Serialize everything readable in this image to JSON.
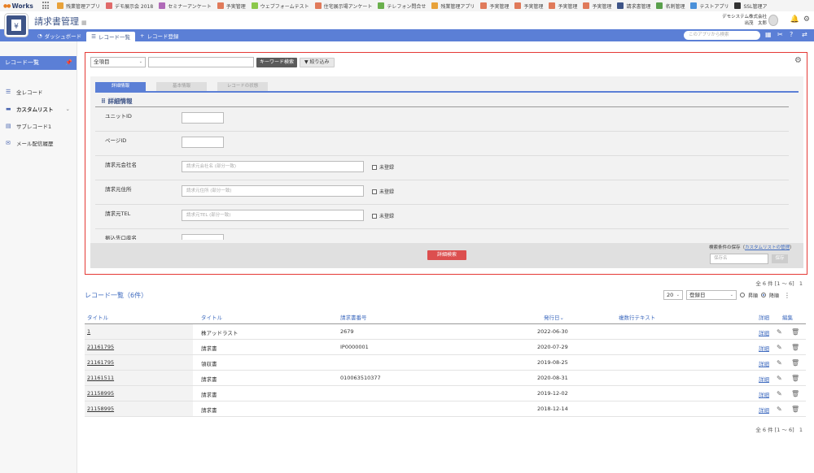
{
  "topbar": {
    "logo_text": "Works",
    "apps": [
      {
        "label": "残業管理アプリ",
        "color": "#e8a23a"
      },
      {
        "label": "デモ展示会 2018",
        "color": "#e06a6a"
      },
      {
        "label": "セミナーアンケート",
        "color": "#b06ab8"
      },
      {
        "label": "予実管理",
        "color": "#e07a5a"
      },
      {
        "label": "ウェブフォームテスト",
        "color": "#8cc84b"
      },
      {
        "label": "住宅展示場アンケート",
        "color": "#e07a5a"
      },
      {
        "label": "テレフォン問合せ",
        "color": "#6ab04c"
      },
      {
        "label": "残業管理アプリ",
        "color": "#e8a23a"
      },
      {
        "label": "予実管理",
        "color": "#e07a5a"
      },
      {
        "label": "予実管理",
        "color": "#e07a5a"
      },
      {
        "label": "予実管理",
        "color": "#e07a5a"
      },
      {
        "label": "予実管理",
        "color": "#e07a5a"
      },
      {
        "label": "請求書管理",
        "color": "#3e5487"
      },
      {
        "label": "名刺管理",
        "color": "#5aa04c"
      },
      {
        "label": "テストアプリ",
        "color": "#4a90d9"
      },
      {
        "label": "SSL管理ア",
        "color": "#333333"
      }
    ]
  },
  "header": {
    "app_title": "請求書管理",
    "calendar_glyph": "▦",
    "company": "デモシステム株式会社",
    "user": "出茂　太郎"
  },
  "nav": {
    "tabs": [
      "ダッシュボード",
      "レコード一覧",
      "レコード登録"
    ],
    "active_tab": 1,
    "search_placeholder": "このアプリから検索"
  },
  "sidebar": {
    "header": "レコード一覧",
    "items": [
      "全レコード",
      "カスタムリスト",
      "サブレコード1",
      "メール配信履歴"
    ]
  },
  "search": {
    "field_select": "全項目",
    "keyword_button": "キーワード検索",
    "filter_button": "絞り込み",
    "tabs": [
      "詳細情報",
      "基本情報",
      "レコードの状態"
    ],
    "section_title": "詳細情報",
    "fields": [
      {
        "label": "ユニットID",
        "placeholder": "",
        "checkbox": ""
      },
      {
        "label": "ページID",
        "placeholder": "",
        "checkbox": ""
      },
      {
        "label": "請求元会社名",
        "placeholder": "請求元会社名 (部分一致)",
        "checkbox": "未登録"
      },
      {
        "label": "請求元住所",
        "placeholder": "請求元住所 (部分一致)",
        "checkbox": "未登録"
      },
      {
        "label": "請求元TEL",
        "placeholder": "請求元TEL (部分一致)",
        "checkbox": "未登録"
      },
      {
        "label": "振込先口座名",
        "placeholder": "",
        "checkbox": ""
      }
    ],
    "detail_search_button": "詳細検索",
    "save_label_prefix": "検索条件の保存（",
    "save_label_link": "カスタムリストの管理",
    "save_label_suffix": "）",
    "save_placeholder": "保存名",
    "save_button": "保存"
  },
  "list": {
    "title": "レコード一覧（6件）",
    "pager_text": "全 6 件 [1 〜 6]",
    "page_number": "1",
    "per_page": "20",
    "sort_field": "登録日",
    "order_asc": "昇順",
    "order_desc": "降順",
    "headers": [
      "タイトル",
      "タイトル",
      "請求書番号",
      "発行日",
      "複数行テキスト",
      "詳細",
      "編集"
    ],
    "sort_indicator": "⌄",
    "detail_link": "詳細",
    "rows": [
      {
        "id": "1",
        "title": "株アッドラスト",
        "number": "2679",
        "date": "2022-06-30",
        "text": ""
      },
      {
        "id": "21161795",
        "title": "請求書",
        "number": "IP0000001",
        "date": "2020-07-29",
        "text": ""
      },
      {
        "id": "21161795",
        "title": "領収書",
        "number": "",
        "date": "2019-08-25",
        "text": ""
      },
      {
        "id": "21161511",
        "title": "請求書",
        "number": "010063510377",
        "date": "2020-08-31",
        "text": ""
      },
      {
        "id": "21158995",
        "title": "請求書",
        "number": "",
        "date": "2019-12-02",
        "text": ""
      },
      {
        "id": "21158995",
        "title": "請求書",
        "number": "",
        "date": "2018-12-14",
        "text": ""
      }
    ]
  },
  "colors": {
    "accent": "#5b7fd6",
    "brand": "#3e5487",
    "danger": "#dc4f4f",
    "highlight": "#e53935"
  }
}
